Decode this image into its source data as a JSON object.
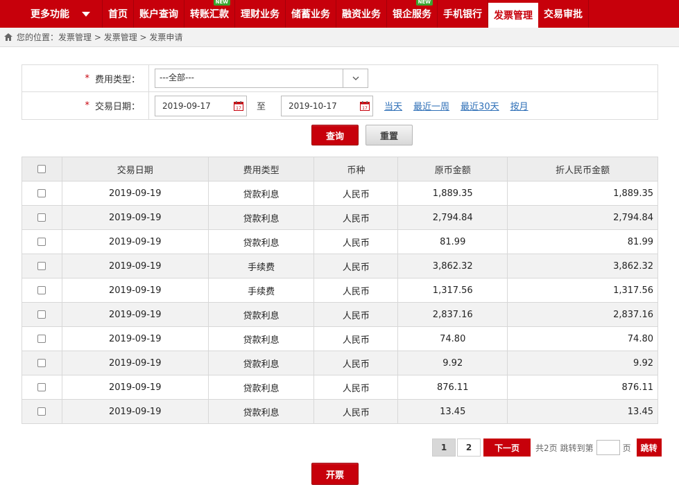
{
  "nav": {
    "more": "更多功能",
    "items": [
      {
        "label": "首页",
        "new": false
      },
      {
        "label": "账户查询",
        "new": false
      },
      {
        "label": "转账汇款",
        "new": true
      },
      {
        "label": "理财业务",
        "new": false
      },
      {
        "label": "储蓄业务",
        "new": false
      },
      {
        "label": "融资业务",
        "new": false
      },
      {
        "label": "银企服务",
        "new": true
      },
      {
        "label": "手机银行",
        "new": false
      },
      {
        "label": "发票管理",
        "new": false,
        "active": true
      },
      {
        "label": "交易审批",
        "new": false
      }
    ],
    "new_badge": "NEW"
  },
  "breadcrumb": {
    "prefix": "您的位置：",
    "path": "发票管理 > 发票管理 > 发票申请"
  },
  "form": {
    "fee_type_label": "费用类型：",
    "fee_type_value": "---全部---",
    "date_label": "交易日期：",
    "required_mark": "*",
    "date_from": "2019-09-17",
    "date_sep": "至",
    "date_to": "2019-10-17",
    "quick": [
      "当天",
      "最近一周",
      "最近30天",
      "按月"
    ]
  },
  "buttons": {
    "query": "查询",
    "reset": "重置",
    "issue": "开票"
  },
  "table": {
    "headers": [
      "交易日期",
      "费用类型",
      "币种",
      "原币金额",
      "折人民币金额"
    ],
    "rows": [
      [
        "2019-09-19",
        "贷款利息",
        "人民币",
        "1,889.35",
        "1,889.35"
      ],
      [
        "2019-09-19",
        "贷款利息",
        "人民币",
        "2,794.84",
        "2,794.84"
      ],
      [
        "2019-09-19",
        "贷款利息",
        "人民币",
        "81.99",
        "81.99"
      ],
      [
        "2019-09-19",
        "手续费",
        "人民币",
        "3,862.32",
        "3,862.32"
      ],
      [
        "2019-09-19",
        "手续费",
        "人民币",
        "1,317.56",
        "1,317.56"
      ],
      [
        "2019-09-19",
        "贷款利息",
        "人民币",
        "2,837.16",
        "2,837.16"
      ],
      [
        "2019-09-19",
        "贷款利息",
        "人民币",
        "74.80",
        "74.80"
      ],
      [
        "2019-09-19",
        "贷款利息",
        "人民币",
        "9.92",
        "9.92"
      ],
      [
        "2019-09-19",
        "贷款利息",
        "人民币",
        "876.11",
        "876.11"
      ],
      [
        "2019-09-19",
        "贷款利息",
        "人民币",
        "13.45",
        "13.45"
      ]
    ]
  },
  "pager": {
    "pages": [
      "1",
      "2"
    ],
    "current": "1",
    "next": "下一页",
    "total": "共2页",
    "goto": "跳转到第",
    "page_unit": "页",
    "jump": "跳转"
  },
  "colors": {
    "brand": "#c7000b",
    "link": "#2e6fb7"
  }
}
